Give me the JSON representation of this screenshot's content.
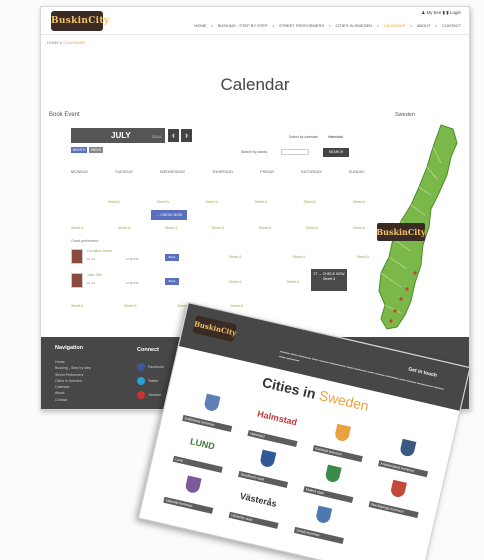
{
  "back_page": {
    "logo": "BuskinCity",
    "user_bar": "♟ My bee ▮ ▮ Login",
    "nav": [
      "HOME",
      "BUSKING - STEP BY STEP",
      "STREET PERFORMERS",
      "CITIES IN SWEDEN",
      "CALENDAR",
      "ABOUT",
      "CONTACT"
    ],
    "breadcrumb": {
      "home": "HOME",
      "current": "CALENDAR"
    },
    "title": "Calendar",
    "book_event": "Book Event",
    "sweden": "Sweden",
    "month": "JULY",
    "year": "2014",
    "tabs": [
      "MONTH",
      "WEEK"
    ],
    "select_calendar": "Select by calendar",
    "select_value": "Halmstad",
    "search_by_words": "Search by words",
    "search_button": "SEARCH",
    "weekdays": [
      "MONDAY",
      "TUESDAY",
      "WEDNESDAY",
      "THURSDAY",
      "FRIDAY",
      "SATURDAY",
      "SUNDAY"
    ],
    "cell_text": "Street A",
    "event_chip": "→ CHECK NOW",
    "event_chip2": "27 → CHECK NOW",
    "event_chip2_sub": "Street 3",
    "guest_heading": "Guest performers",
    "guests": [
      {
        "name": "Cornelius Aaron",
        "date": "14 Jul",
        "time": "12:00 PM",
        "street": "Street",
        "go": "Book"
      },
      {
        "name": "Jake Tate",
        "date": "14 Jul",
        "time": "12:00 PM",
        "street": "Street",
        "go": "Book"
      }
    ],
    "footer": {
      "navigation": "Navigation",
      "links": [
        "Home",
        "Busking - Step by step",
        "Street Performers",
        "Cities in Sweden",
        "Calendar",
        "About",
        "Contact"
      ],
      "connect": "Connect",
      "social": [
        "Facebook",
        "Twitter",
        "Youtube"
      ]
    }
  },
  "front_page": {
    "logo": "BuskinCity",
    "get_in_touch": "Get in touch",
    "title_part1": "Cities in",
    "title_part2": "Sweden",
    "cities": [
      {
        "label": "Eskilstuna",
        "name": "Eskilstuna kommun",
        "mark": "",
        "color": "#5f7fb6"
      },
      {
        "label": "Halmstad",
        "name": "Halmstad",
        "mark": "Halmstad",
        "color": "#c23a3a"
      },
      {
        "label": "Karlstad",
        "name": "Karlstad kommun",
        "mark": "",
        "color": "#e8a340"
      },
      {
        "label": "Kristianstad",
        "name": "Kristianstads kommun",
        "mark": "",
        "color": "#3a5a84"
      },
      {
        "label": "Lund",
        "name": "Lund",
        "mark": "LUND",
        "color": "#3b7a3b"
      },
      {
        "label": "Stockholm",
        "name": "Stockholm stad",
        "mark": "",
        "color": "#2e5a9a"
      },
      {
        "label": "Malmö",
        "name": "Malmö stad",
        "mark": "",
        "color": "#3a8a4a"
      },
      {
        "label": "Norrköping",
        "name": "Norrköpings kommun",
        "mark": "",
        "color": "#c24a3a"
      },
      {
        "label": "Uppsala",
        "name": "Uppsala kommun",
        "mark": "",
        "color": "#7a5a9a"
      },
      {
        "label": "Västerås",
        "name": "Västerås stad",
        "mark": "Västerås",
        "color": "#333333"
      },
      {
        "label": "Umeå",
        "name": "Umeå kommun",
        "mark": "",
        "color": "#4a7ab0"
      }
    ]
  },
  "colors": {
    "accent": "#e8a340",
    "green_link": "#8cb04f",
    "dark": "#474747",
    "blue_chip": "#5b6fbf"
  }
}
